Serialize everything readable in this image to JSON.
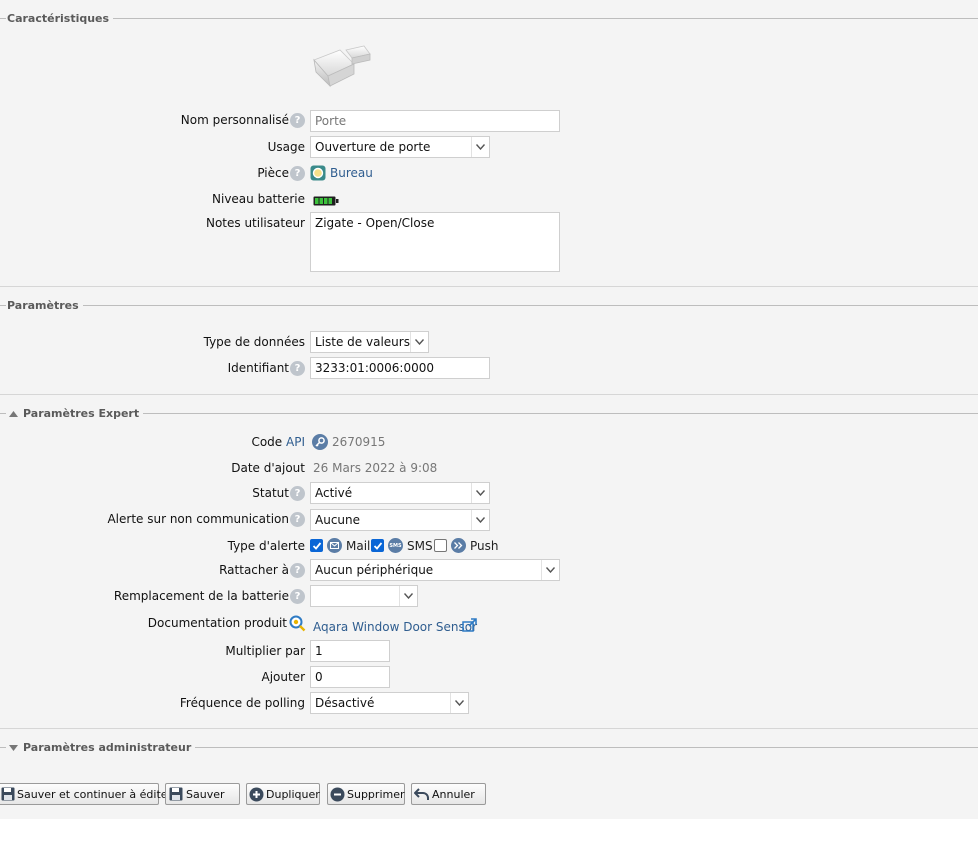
{
  "sections": {
    "caracteristiques": "Caractéristiques",
    "parametres": "Paramètres",
    "expert": "Paramètres Expert",
    "admin": "Paramètres administrateur"
  },
  "caracteristiques": {
    "nom_label": "Nom personnalisé",
    "nom_placeholder": "Porte",
    "usage_label": "Usage",
    "usage_value": "Ouverture de porte",
    "piece_label": "Pièce",
    "piece_value": "Bureau",
    "batterie_label": "Niveau batterie",
    "batterie_level": 1.0,
    "notes_label": "Notes utilisateur",
    "notes_value": "Zigate - Open/Close"
  },
  "parametres": {
    "type_label": "Type de données",
    "type_value": "Liste de valeurs",
    "id_label": "Identifiant",
    "id_value": "3233:01:0006:0000"
  },
  "expert": {
    "code_label": "Code",
    "code_api_link": "API",
    "code_value": "2670915",
    "date_label": "Date d'ajout",
    "date_value": "26 Mars 2022 à 9:08",
    "statut_label": "Statut",
    "statut_value": "Activé",
    "alerte_label": "Alerte sur non communication",
    "alerte_value": "Aucune",
    "type_alerte_label": "Type d'alerte",
    "mail_label": "Mail",
    "mail_checked": true,
    "sms_label": "SMS",
    "sms_badge": "SMS",
    "sms_checked": true,
    "push_label": "Push",
    "push_checked": false,
    "rattacher_label": "Rattacher à",
    "rattacher_value": "Aucun périphérique",
    "remplacement_label": "Remplacement de la batterie",
    "remplacement_value": "",
    "doc_label": "Documentation produit",
    "doc_link": "Aqara Window Door Sensor",
    "multiplier_label": "Multiplier par",
    "multiplier_value": "1",
    "ajouter_label": "Ajouter",
    "ajouter_value": "0",
    "polling_label": "Fréquence de polling",
    "polling_value": "Désactivé"
  },
  "buttons": {
    "save_continue": "Sauver et continuer à éditer",
    "save": "Sauver",
    "duplicate": "Dupliquer",
    "delete": "Supprimer",
    "cancel": "Annuler"
  },
  "help_glyph": "?",
  "colors": {
    "link": "#2f5d8f",
    "checkbox": "#0a66d6",
    "panel_bg": "#f4f4f4",
    "battery": "#2e9b2e"
  }
}
